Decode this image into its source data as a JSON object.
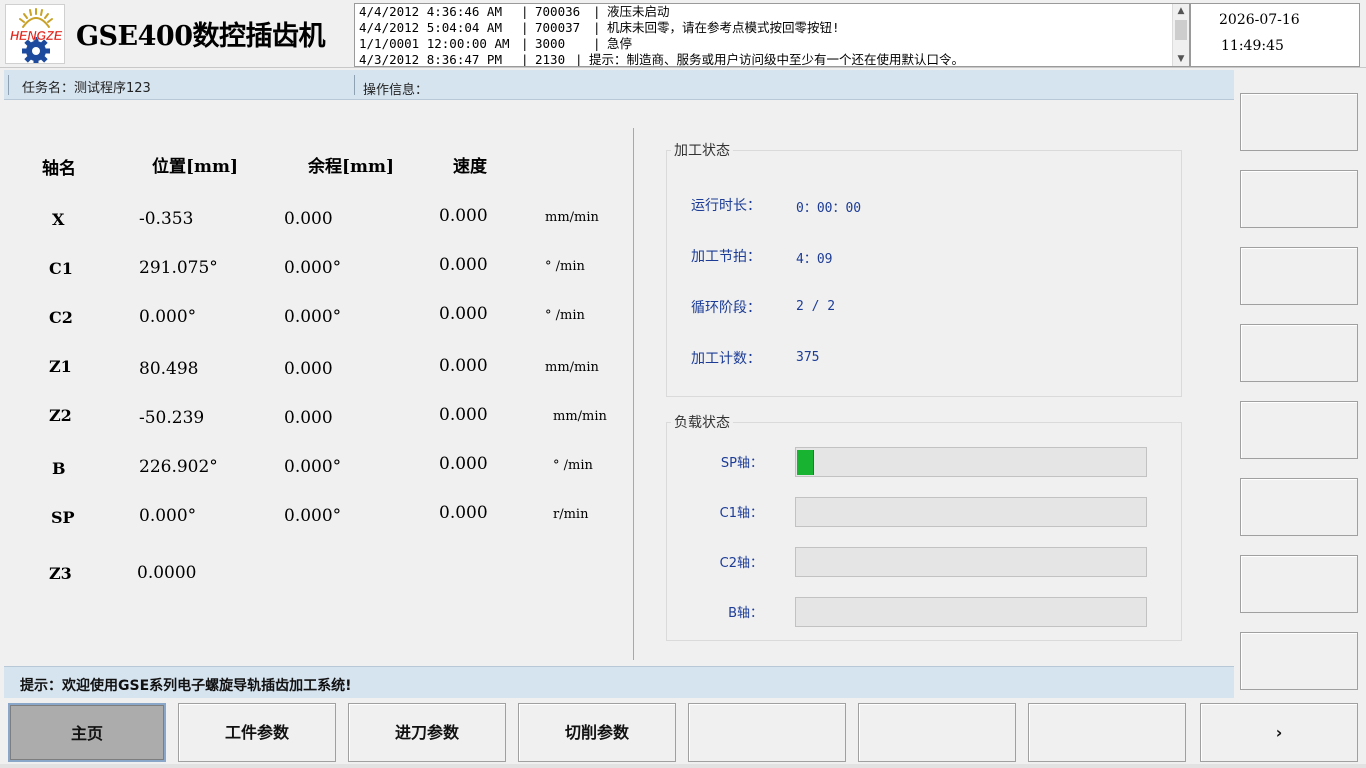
{
  "header": {
    "logo_text": "HENGZE",
    "title": "GSE400数控插齿机",
    "alarms": [
      {
        "time": "4/4/2012 4:36:46 AM",
        "code": "700036",
        "message": "液压未启动"
      },
      {
        "time": "4/4/2012 5:04:04 AM",
        "code": "700037",
        "message": "机床未回零，请在参考点模式按回零按钮!"
      },
      {
        "time": "1/1/0001 12:00:00 AM",
        "code": "3000",
        "message": "急停"
      },
      {
        "time": "4/3/2012 8:36:47 PM",
        "code": "2130",
        "message": "提示：制造商、服务或用户访问级中至少有一个还在使用默认口令。"
      }
    ],
    "date": "2026-07-16",
    "time": "11:49:45",
    "scroll_up": "▲",
    "scroll_down": "▼"
  },
  "info_bar": {
    "task": "任务名：测试程序123",
    "operation": "操作信息："
  },
  "axes": {
    "headers": {
      "name": "轴名",
      "position": "位置[mm]",
      "remaining": "余程[mm]",
      "speed": "速度"
    },
    "rows": [
      {
        "name": "X",
        "position": "-0.353",
        "remaining": "0.000",
        "speed": "0.000",
        "unit": "mm/min"
      },
      {
        "name": "C1",
        "position": "291.075°",
        "remaining": "0.000°",
        "speed": "0.000",
        "unit": "° /min"
      },
      {
        "name": "C2",
        "position": "0.000°",
        "remaining": "0.000°",
        "speed": "0.000",
        "unit": "° /min"
      },
      {
        "name": "Z1",
        "position": "80.498",
        "remaining": "0.000",
        "speed": "0.000",
        "unit": "mm/min"
      },
      {
        "name": "Z2",
        "position": "-50.239",
        "remaining": "0.000",
        "speed": "0.000",
        "unit": "mm/min"
      },
      {
        "name": "B",
        "position": "226.902°",
        "remaining": "0.000°",
        "speed": "0.000",
        "unit": "° /min"
      },
      {
        "name": "SP",
        "position": "0.000°",
        "remaining": "0.000°",
        "speed": "0.000",
        "unit": "r/min"
      },
      {
        "name": "Z3",
        "position": "0.0000"
      }
    ]
  },
  "machining_status": {
    "title": "加工状态",
    "items": [
      {
        "label": "运行时长：",
        "value": "0：00：00"
      },
      {
        "label": "加工节拍：",
        "value": "4：09"
      },
      {
        "label": "循环阶段：",
        "value": "2 / 2"
      },
      {
        "label": "加工计数：",
        "value": "375"
      }
    ]
  },
  "load_status": {
    "title": "负载状态",
    "items": [
      {
        "label": "SP轴：",
        "percent": 5
      },
      {
        "label": "C1轴：",
        "percent": 0
      },
      {
        "label": "C2轴：",
        "percent": 0
      },
      {
        "label": "B轴：",
        "percent": 0
      }
    ],
    "fill_color": "#18b330"
  },
  "hint": "提示：欢迎使用GSE系列电子螺旋导轨插齿加工系统!",
  "tabs": [
    {
      "label": "主页",
      "active": true
    },
    {
      "label": "工件参数"
    },
    {
      "label": "进刀参数"
    },
    {
      "label": "切削参数"
    },
    {
      "label": ""
    },
    {
      "label": ""
    },
    {
      "label": ""
    },
    {
      "label": "›"
    }
  ],
  "colors": {
    "panel_blue": "#d6e4f0",
    "status_text": "#1c3c96",
    "active_tab": "#acacac"
  }
}
